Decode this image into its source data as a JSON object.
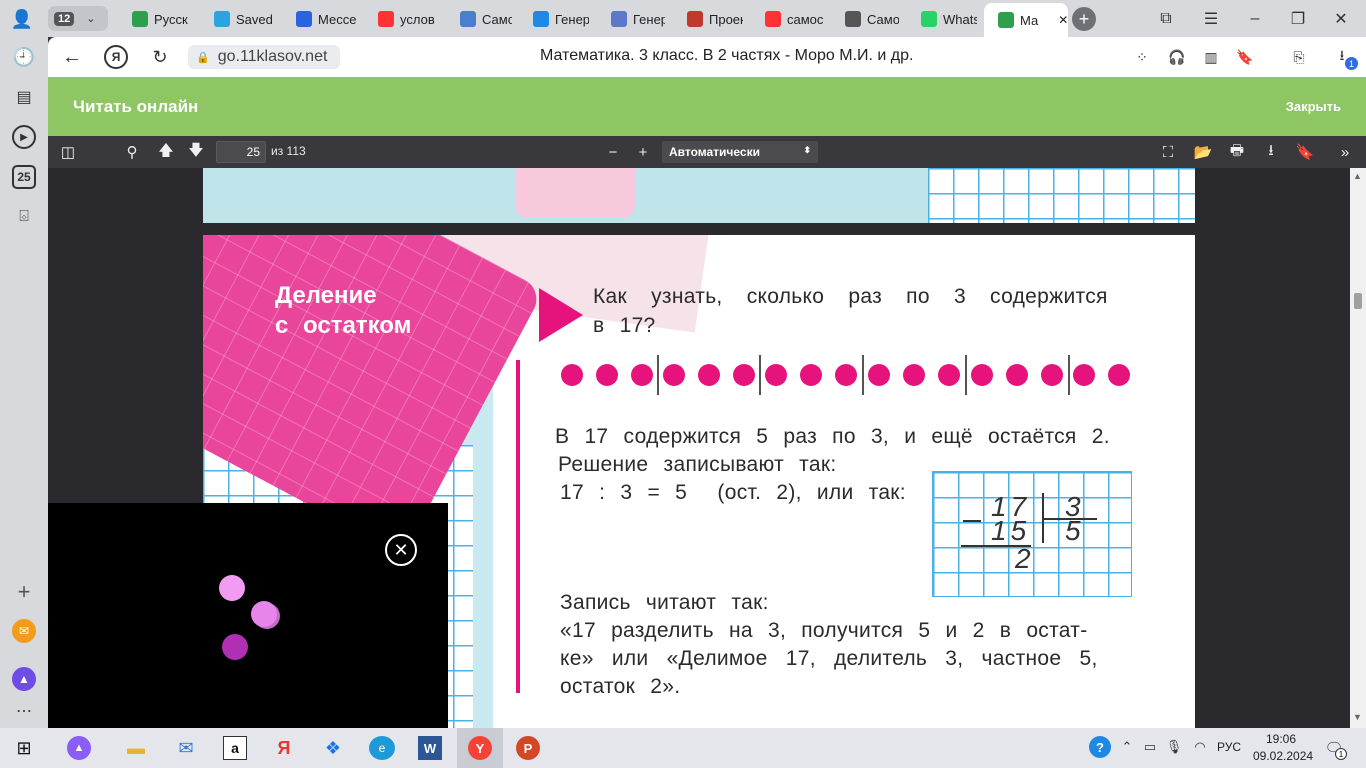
{
  "tabs": {
    "counter": "12",
    "items": [
      {
        "label": "Русск",
        "icon": "book-icon",
        "color": "#2e9e4f"
      },
      {
        "label": "Saved",
        "icon": "telegram-icon",
        "color": "#2aa3df"
      },
      {
        "label": "Мессе",
        "icon": "messenger-icon",
        "color": "#2a62e0"
      },
      {
        "label": "услов",
        "icon": "yandex-icon",
        "color": "#f33"
      },
      {
        "label": "Самос",
        "icon": "site-icon",
        "color": "#4a7fd0"
      },
      {
        "label": "Генер",
        "icon": "s-icon",
        "color": "#1e88e5"
      },
      {
        "label": "Генер",
        "icon": "grid-icon",
        "color": "#5b78c9"
      },
      {
        "label": "Проек",
        "icon": "bars-icon",
        "color": "#c0392b"
      },
      {
        "label": "самос",
        "icon": "yandex-icon",
        "color": "#f33"
      },
      {
        "label": "Самос",
        "icon": "owl-icon",
        "color": "#555"
      },
      {
        "label": "Whats",
        "icon": "whatsapp-icon",
        "color": "#25d366"
      },
      {
        "label": "Ма",
        "icon": "book-icon",
        "color": "#2e9e4f"
      }
    ]
  },
  "sidebar": {
    "badge": "25"
  },
  "address": {
    "url": "go.11klasov.net",
    "title": "Математика. 3 класс. В 2 частях - Моро М.И. и др.",
    "downloads_badge": "1"
  },
  "banner": {
    "title": "Читать онлайн",
    "close": "Закрыть"
  },
  "pdf": {
    "page": "25",
    "of": "из 113",
    "zoom": "Автоматически"
  },
  "book": {
    "heading1": "Деление",
    "heading2": "с остатком",
    "question1": "Как узнать, сколько раз по 3 содержится",
    "question2": "в 17?",
    "line1": "В 17 содержится 5 раз по 3, и ещё остаётся 2.",
    "line2": "Решение записывают так:",
    "line3": "17 : 3 = 5  (ост. 2), или так:",
    "line4": "Запись читают так:",
    "line5": "«17 разделить на 3, получится 5 и 2 в остат-",
    "line6": "ке» или «Делимое 17, делитель 3, частное 5,",
    "line7": "остаток 2».",
    "div": {
      "dividend": "17",
      "divisor": "3",
      "product": "15",
      "quotient": "5",
      "remainder": "2"
    }
  },
  "taskbar": {
    "lang": "РУС",
    "time": "19:06",
    "date": "09.02.2024",
    "notif": "1"
  }
}
